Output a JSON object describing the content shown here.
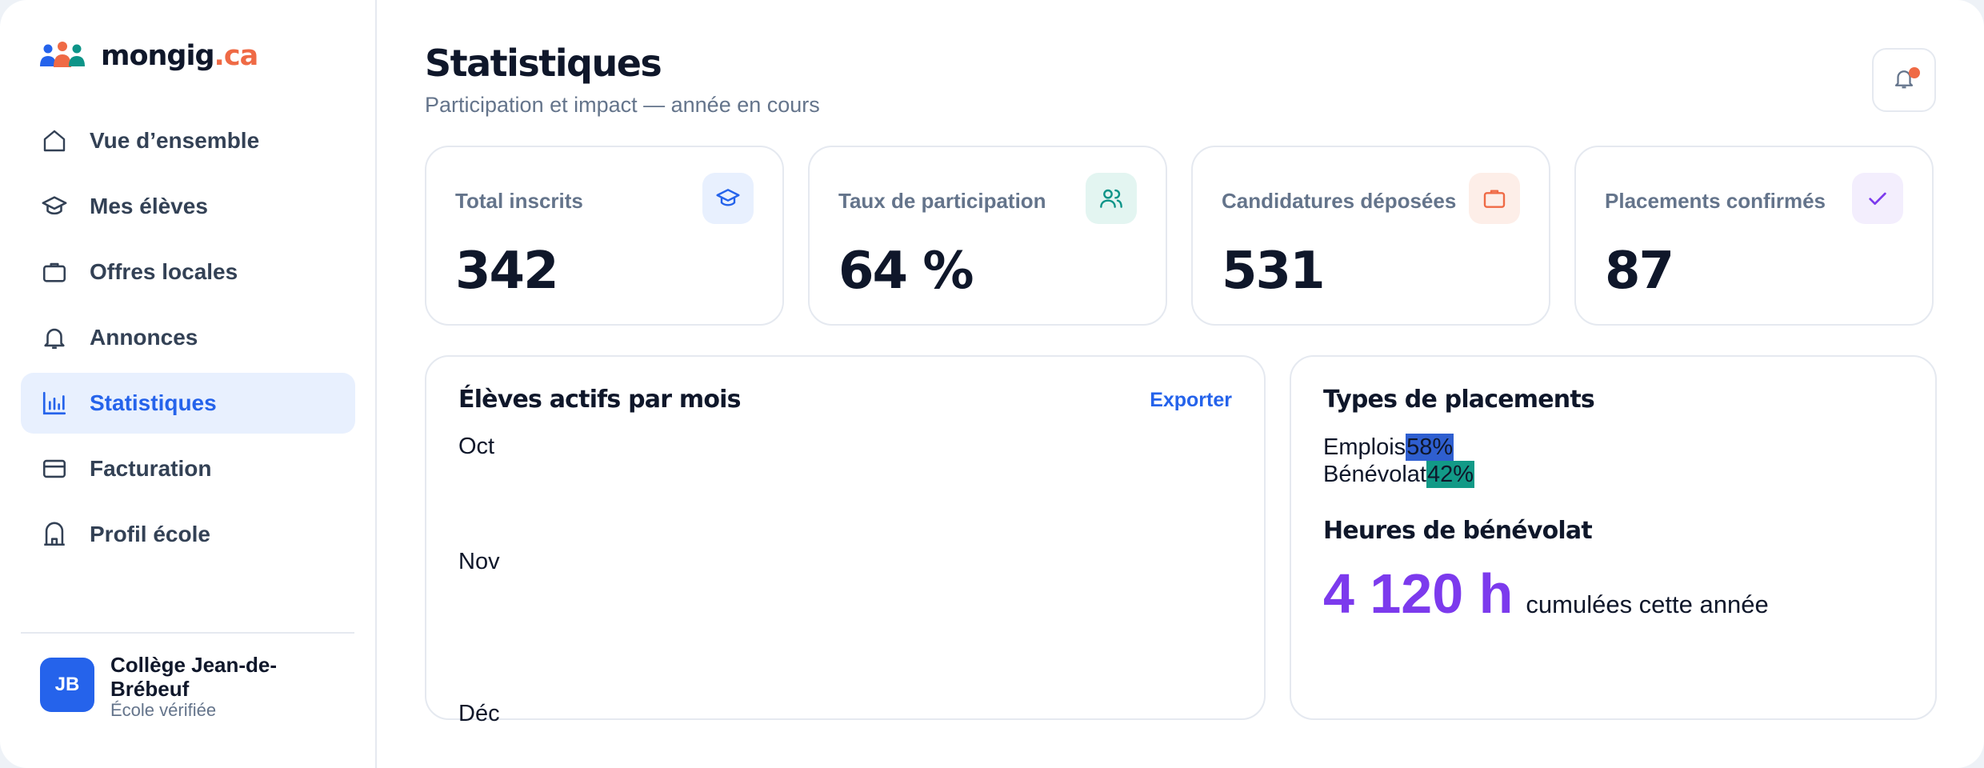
{
  "app": {
    "logo_main": "mongig",
    "logo_accent": ".ca"
  },
  "sidebar": {
    "items": [
      {
        "label": "Vue d’ensemble",
        "icon": "home-icon"
      },
      {
        "label": "Mes élèves",
        "icon": "graduation-cap-icon"
      },
      {
        "label": "Offres locales",
        "icon": "briefcase-icon"
      },
      {
        "label": "Annonces",
        "icon": "bell-icon"
      },
      {
        "label": "Statistiques",
        "icon": "bar-chart-icon",
        "active": true
      },
      {
        "label": "Facturation",
        "icon": "credit-card-icon"
      },
      {
        "label": "Profil école",
        "icon": "school-building-icon"
      }
    ],
    "school": {
      "initials": "JB",
      "name": "Collège Jean-de-Brébeuf",
      "status": "École vérifiée"
    }
  },
  "header": {
    "title": "Statistiques",
    "subtitle": "Participation et impact — année en cours"
  },
  "stats": [
    {
      "label": "Total inscrits",
      "value": "342",
      "icon": "graduation-cap-icon",
      "color": "#2563eb",
      "bg": "#e8f0fe"
    },
    {
      "label": "Taux de participation",
      "value": "64 %",
      "icon": "users-icon",
      "color": "#0d9488",
      "bg": "#e3f5f1"
    },
    {
      "label": "Candidatures déposées",
      "value": "531",
      "icon": "briefcase-icon",
      "color": "#ef6a45",
      "bg": "#fdeee8"
    },
    {
      "label": "Placements confirmés",
      "value": "87",
      "icon": "check-icon",
      "color": "#7c3aed",
      "bg": "#f3eefd"
    }
  ],
  "chart_panel": {
    "title": "Élèves actifs par mois",
    "export_label": "Exporter",
    "months": [
      "Oct",
      "Nov",
      "Déc"
    ]
  },
  "types_panel": {
    "title": "Types de placements",
    "types": [
      {
        "label": "Emplois",
        "pct": "58%",
        "color": "#2f5fd0"
      },
      {
        "label": "Bénévolat",
        "pct": "42%",
        "color": "#129a87"
      }
    ],
    "hours_title": "Heures de bénévolat",
    "hours_value": "4 120 h",
    "hours_caption": "cumulées cette année",
    "hours_color": "#7c3aed"
  }
}
